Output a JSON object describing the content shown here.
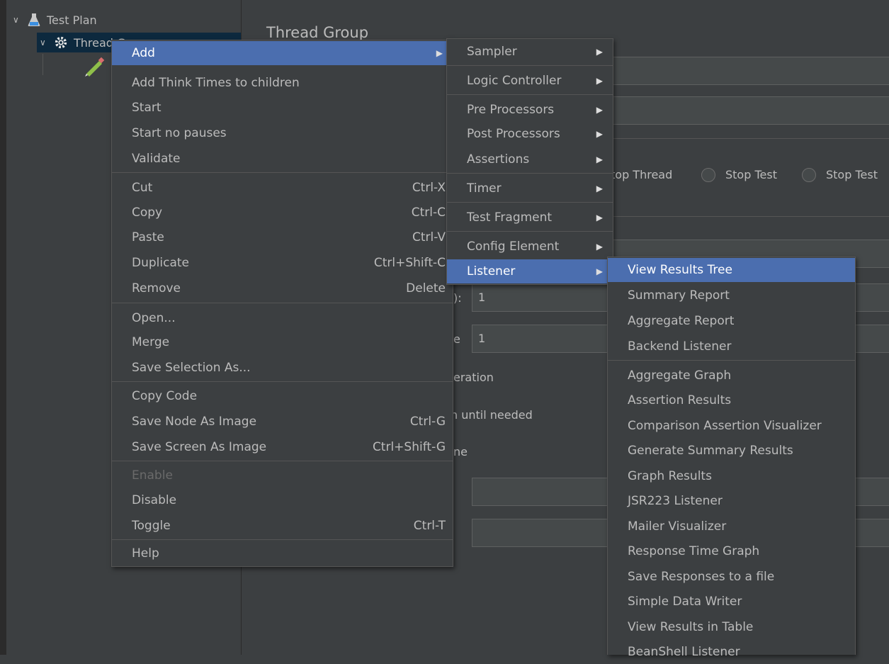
{
  "tree": {
    "items": [
      {
        "label": "Test Plan"
      },
      {
        "label": "Thread Group"
      }
    ]
  },
  "editor": {
    "title": "Thread Group",
    "stop_thread": "top Thread",
    "stop_test": "Stop Test",
    "stop_test_now": "Stop Test",
    "threads_suffix": "):",
    "threads_value": "1",
    "loop_suffix": "e",
    "loop_value": "1",
    "same_user": "eration",
    "delay_thread": "n until needed",
    "scheduler": "ne"
  },
  "context_menu": {
    "items": [
      {
        "label": "Add",
        "shortcut": ""
      },
      {
        "label": "Add Think Times to children",
        "shortcut": ""
      },
      {
        "label": "Start",
        "shortcut": ""
      },
      {
        "label": "Start no pauses",
        "shortcut": ""
      },
      {
        "label": "Validate",
        "shortcut": ""
      },
      {
        "label": "Cut",
        "shortcut": "Ctrl-X"
      },
      {
        "label": "Copy",
        "shortcut": "Ctrl-C"
      },
      {
        "label": "Paste",
        "shortcut": "Ctrl-V"
      },
      {
        "label": "Duplicate",
        "shortcut": "Ctrl+Shift-C"
      },
      {
        "label": "Remove",
        "shortcut": "Delete"
      },
      {
        "label": "Open...",
        "shortcut": ""
      },
      {
        "label": "Merge",
        "shortcut": ""
      },
      {
        "label": "Save Selection As...",
        "shortcut": ""
      },
      {
        "label": "Copy Code",
        "shortcut": ""
      },
      {
        "label": "Save Node As Image",
        "shortcut": "Ctrl-G"
      },
      {
        "label": "Save Screen As Image",
        "shortcut": "Ctrl+Shift-G"
      },
      {
        "label": "Enable",
        "shortcut": ""
      },
      {
        "label": "Disable",
        "shortcut": ""
      },
      {
        "label": "Toggle",
        "shortcut": "Ctrl-T"
      },
      {
        "label": "Help",
        "shortcut": ""
      }
    ]
  },
  "add_menu": {
    "items": [
      {
        "label": "Sampler"
      },
      {
        "label": "Logic Controller"
      },
      {
        "label": "Pre Processors"
      },
      {
        "label": "Post Processors"
      },
      {
        "label": "Assertions"
      },
      {
        "label": "Timer"
      },
      {
        "label": "Test Fragment"
      },
      {
        "label": "Config Element"
      },
      {
        "label": "Listener"
      }
    ]
  },
  "listener_menu": {
    "items": [
      {
        "label": "View Results Tree"
      },
      {
        "label": "Summary Report"
      },
      {
        "label": "Aggregate Report"
      },
      {
        "label": "Backend Listener"
      },
      {
        "label": "Aggregate Graph"
      },
      {
        "label": "Assertion Results"
      },
      {
        "label": "Comparison Assertion Visualizer"
      },
      {
        "label": "Generate Summary Results"
      },
      {
        "label": "Graph Results"
      },
      {
        "label": "JSR223 Listener"
      },
      {
        "label": "Mailer Visualizer"
      },
      {
        "label": "Response Time Graph"
      },
      {
        "label": "Save Responses to a file"
      },
      {
        "label": "Simple Data Writer"
      },
      {
        "label": "View Results in Table"
      },
      {
        "label": "BeanShell Listener"
      }
    ]
  },
  "colors": {
    "background": "#3c3f41",
    "highlight": "#4b6eaf",
    "text": "#bbbbbb"
  }
}
